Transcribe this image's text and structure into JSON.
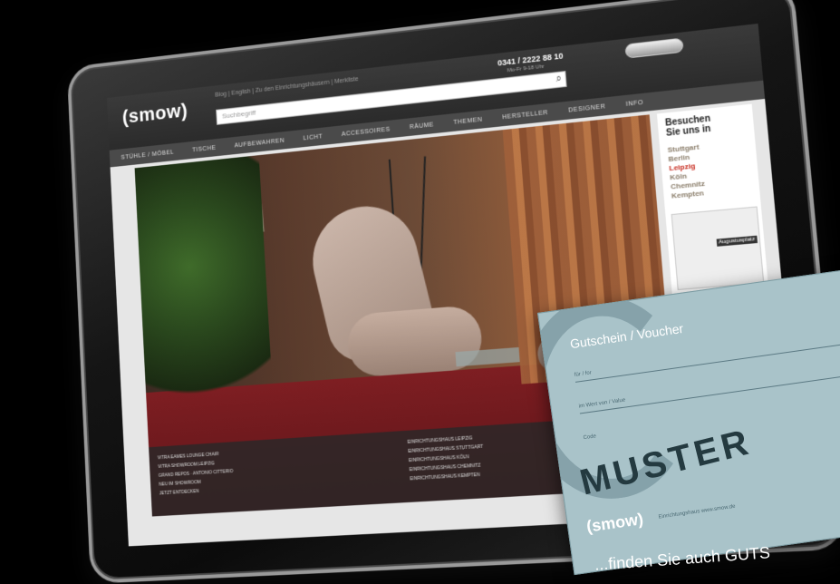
{
  "site": {
    "logo": "(smow)",
    "top_links": "Blog | English | Zu den Einrichtungshäusern | Merkliste",
    "search_placeholder": "Suchbegriff",
    "phone": "0341 / 2222 88 10",
    "phone_hours": "Mo-Fr 9-18 Uhr",
    "nav": [
      "STÜHLE / MÖBEL",
      "TISCHE",
      "AUFBEWAHREN",
      "LICHT",
      "ACCESSOIRES",
      "RÄUME",
      "THEMEN",
      "HERSTELLER",
      "DESIGNER",
      "INFO"
    ]
  },
  "hero": {
    "caption_left": [
      "VITRA EAMES LOUNGE CHAIR",
      "VITRA SHOWROOM LEIPZIG",
      "GRAND REPOS · ANTONIO CITTERIO",
      "NEU IM SHOWROOM",
      "JETZT ENTDECKEN"
    ],
    "caption_right": [
      "EINRICHTUNGSHAUS LEIPZIG",
      "EINRICHTUNGSHAUS STUTTGART",
      "EINRICHTUNGSHAUS KÖLN",
      "EINRICHTUNGSHAUS CHEMNITZ",
      "EINRICHTUNGSHAUS KEMPTEN"
    ]
  },
  "side_panel": {
    "title_line1": "Besuchen",
    "title_line2": "Sie uns in",
    "cities": [
      "Stuttgart",
      "Berlin",
      "Leipzig",
      "Köln",
      "Chemnitz",
      "Kempten"
    ],
    "active_city": "Leipzig",
    "map_pin": "Augustusplatz"
  },
  "voucher": {
    "title": "Gutschein / Voucher",
    "label_for": "für / for",
    "label_value": "im Wert von / Value",
    "label_code": "Code",
    "muster": "MUSTER",
    "logo": "(smow)",
    "footer": "Einrichtungshaus   www.smow.de"
  },
  "bottom_text": "...finden Sie auch GUTS"
}
